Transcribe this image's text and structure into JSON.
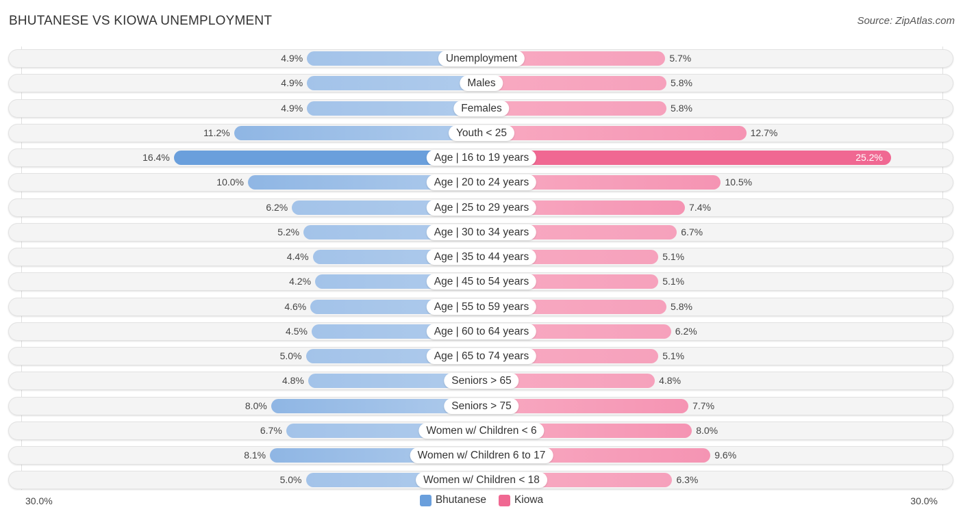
{
  "header": {
    "title": "BHUTANESE VS KIOWA UNEMPLOYMENT",
    "source": "Source: ZipAtlas.com"
  },
  "chart_data": {
    "type": "bar",
    "orientation": "horizontal-diverging",
    "title": "BHUTANESE VS KIOWA UNEMPLOYMENT",
    "xlabel": "",
    "ylabel": "",
    "unit": "%",
    "axis_min_label": "30.0%",
    "axis_max_label": "30.0%",
    "xlim": [
      0,
      30
    ],
    "legend_position": "bottom-center",
    "categories": [
      "Unemployment",
      "Males",
      "Females",
      "Youth < 25",
      "Age | 16 to 19 years",
      "Age | 20 to 24 years",
      "Age | 25 to 29 years",
      "Age | 30 to 34 years",
      "Age | 35 to 44 years",
      "Age | 45 to 54 years",
      "Age | 55 to 59 years",
      "Age | 60 to 64 years",
      "Age | 65 to 74 years",
      "Seniors > 65",
      "Seniors > 75",
      "Women w/ Children < 6",
      "Women w/ Children 6 to 17",
      "Women w/ Children < 18"
    ],
    "series": [
      {
        "name": "Bhutanese",
        "color": "#6a9fdc",
        "light_color": "#a7c6ea",
        "side": "left",
        "values": [
          4.9,
          4.9,
          4.9,
          11.2,
          16.4,
          10.0,
          6.2,
          5.2,
          4.4,
          4.2,
          4.6,
          4.5,
          5.0,
          4.8,
          8.0,
          6.7,
          8.1,
          5.0
        ],
        "labels": [
          "4.9%",
          "4.9%",
          "4.9%",
          "11.2%",
          "16.4%",
          "10.0%",
          "6.2%",
          "5.2%",
          "4.4%",
          "4.2%",
          "4.6%",
          "4.5%",
          "5.0%",
          "4.8%",
          "8.0%",
          "6.7%",
          "8.1%",
          "5.0%"
        ]
      },
      {
        "name": "Kiowa",
        "color": "#f06892",
        "light_color": "#f7a5bf",
        "side": "right",
        "values": [
          5.7,
          5.8,
          5.8,
          12.7,
          25.2,
          10.5,
          7.4,
          6.7,
          5.1,
          5.1,
          5.8,
          6.2,
          5.1,
          4.8,
          7.7,
          8.0,
          9.6,
          6.3
        ],
        "labels": [
          "5.7%",
          "5.8%",
          "5.8%",
          "12.7%",
          "25.2%",
          "10.5%",
          "7.4%",
          "6.7%",
          "5.1%",
          "5.1%",
          "5.8%",
          "6.2%",
          "5.1%",
          "4.8%",
          "7.7%",
          "8.0%",
          "9.6%",
          "6.3%"
        ]
      }
    ]
  },
  "legend": [
    {
      "label": "Bhutanese",
      "color": "#6a9fdc"
    },
    {
      "label": "Kiowa",
      "color": "#f06892"
    }
  ]
}
